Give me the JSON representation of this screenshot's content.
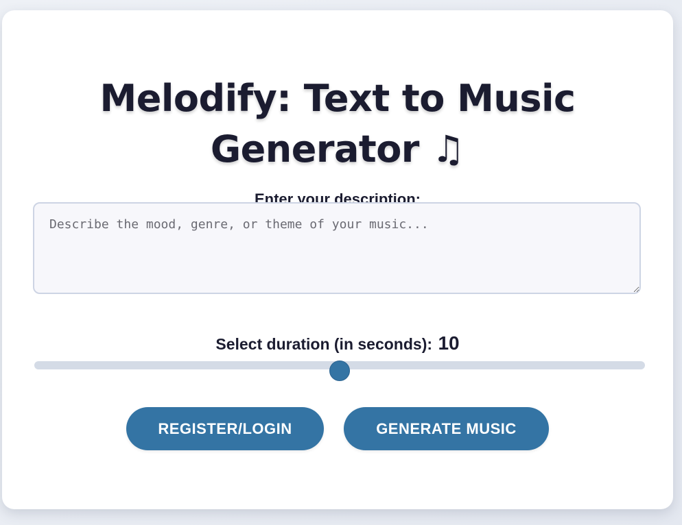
{
  "app": {
    "title": "Melodify: Text to Music Generator",
    "title_icon": "music-note-icon",
    "title_icon_glyph": "♫"
  },
  "description": {
    "label": "Enter your description:",
    "value": "",
    "placeholder": "Describe the mood, genre, or theme of your music..."
  },
  "duration": {
    "label": "Select duration (in seconds):",
    "value": "10",
    "level": 0.5
  },
  "buttons": {
    "register_label": "REGISTER/LOGIN",
    "generate_label": "GENERATE MUSIC"
  },
  "colors": {
    "accent": "#3474a4",
    "text": "#1b1c30",
    "track": "#d4dbe6"
  }
}
